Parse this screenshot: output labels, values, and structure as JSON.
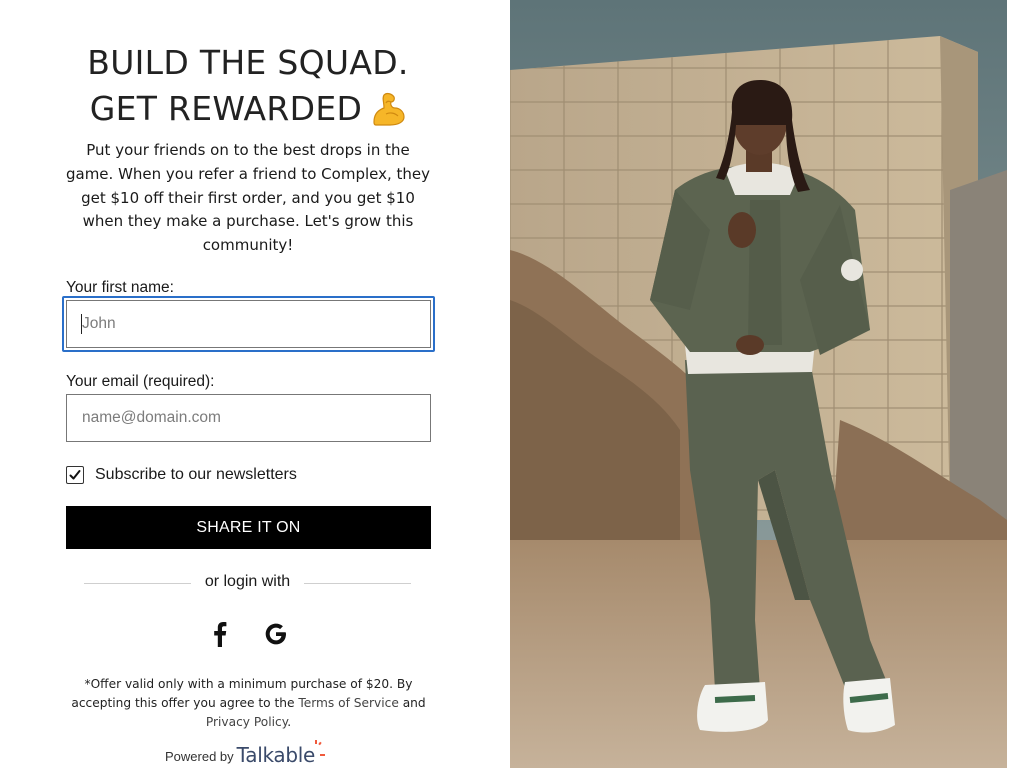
{
  "header": {
    "line1": "BUILD THE SQUAD.",
    "line2": "GET REWARDED"
  },
  "intro": "Put your friends on to the best drops in the game. When you refer a friend to Complex, they get $10 off their first order, and you get $10 when they make a purchase. Let's grow this community!",
  "form": {
    "name_label": "Your first name:",
    "name_placeholder": "John",
    "name_value": "",
    "email_label": "Your email (required):",
    "email_placeholder": "name@domain.com",
    "email_value": "",
    "subscribe_label": "Subscribe to our newsletters",
    "subscribe_checked": true,
    "submit_label": "SHARE IT ON"
  },
  "login": {
    "divider_text": "or login with",
    "providers": [
      {
        "name": "Facebook",
        "icon": "facebook-icon"
      },
      {
        "name": "Google",
        "icon": "google-icon"
      }
    ]
  },
  "disclaimer": {
    "text_before": "*Offer valid only with a minimum purchase of $20. By accepting this offer you agree to the ",
    "terms_link": "Terms of Service",
    "text_middle": " and ",
    "privacy_link": "Privacy Policy",
    "text_after": "."
  },
  "footer": {
    "powered_by": "Powered by",
    "brand": "Talkable"
  },
  "icons": {
    "headline_emoji": "flexed-biceps-icon"
  },
  "colors": {
    "focus_ring": "#2a6fc9",
    "button_bg": "#000000",
    "brand_accent": "#f05a3c",
    "jacket": "#5c6450"
  }
}
